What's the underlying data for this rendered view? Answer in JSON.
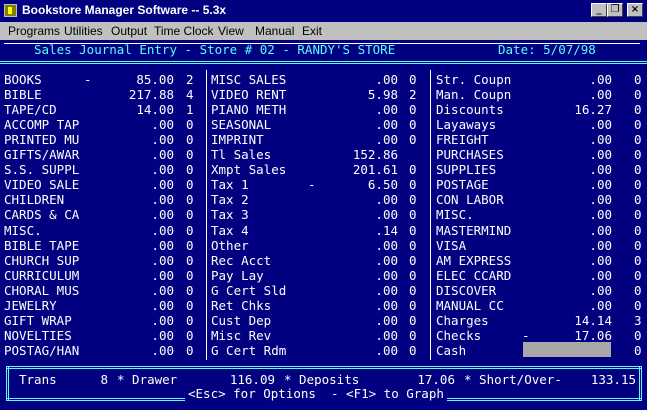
{
  "window": {
    "title": "Bookstore Manager Software -- 5.3x",
    "controls": [
      {
        "name": "minimize-button",
        "glyph": "_"
      },
      {
        "name": "maximize-button",
        "glyph": "❐"
      },
      {
        "name": "close-button",
        "glyph": "×"
      }
    ]
  },
  "menu": [
    "Programs",
    "Utilities",
    "Output",
    "Time Clock",
    "View",
    "Manual",
    "Exit"
  ],
  "header": {
    "title": "Sales Journal Entry - Store # 02 - RANDY'S STORE",
    "date": "Date: 5/07/98"
  },
  "col1": [
    {
      "label": "BOOKS",
      "mark": "-",
      "amount": "85.00",
      "count": "2"
    },
    {
      "label": "BIBLE",
      "mark": "",
      "amount": "217.88",
      "count": "4"
    },
    {
      "label": "TAPE/CD",
      "mark": "",
      "amount": "14.00",
      "count": "1"
    },
    {
      "label": "ACCOMP TAP",
      "mark": "",
      "amount": ".00",
      "count": "0"
    },
    {
      "label": "PRINTED MU",
      "mark": "",
      "amount": ".00",
      "count": "0"
    },
    {
      "label": "GIFTS/AWAR",
      "mark": "",
      "amount": ".00",
      "count": "0"
    },
    {
      "label": "S.S. SUPPL",
      "mark": "",
      "amount": ".00",
      "count": "0"
    },
    {
      "label": "VIDEO SALE",
      "mark": "",
      "amount": ".00",
      "count": "0"
    },
    {
      "label": "CHILDREN",
      "mark": "",
      "amount": ".00",
      "count": "0"
    },
    {
      "label": "CARDS & CA",
      "mark": "",
      "amount": ".00",
      "count": "0"
    },
    {
      "label": "MISC.",
      "mark": "",
      "amount": ".00",
      "count": "0"
    },
    {
      "label": "BIBLE TAPE",
      "mark": "",
      "amount": ".00",
      "count": "0"
    },
    {
      "label": "CHURCH SUP",
      "mark": "",
      "amount": ".00",
      "count": "0"
    },
    {
      "label": "CURRICULUM",
      "mark": "",
      "amount": ".00",
      "count": "0"
    },
    {
      "label": "CHORAL MUS",
      "mark": "",
      "amount": ".00",
      "count": "0"
    },
    {
      "label": "JEWELRY",
      "mark": "",
      "amount": ".00",
      "count": "0"
    },
    {
      "label": "GIFT WRAP",
      "mark": "",
      "amount": ".00",
      "count": "0"
    },
    {
      "label": "NOVELTIES",
      "mark": "",
      "amount": ".00",
      "count": "0"
    },
    {
      "label": "POSTAG/HAN",
      "mark": "",
      "amount": ".00",
      "count": "0"
    }
  ],
  "col2": [
    {
      "label": "MISC SALES",
      "mark": "",
      "amount": ".00",
      "count": "0"
    },
    {
      "label": "VIDEO RENT",
      "mark": "",
      "amount": "5.98",
      "count": "2"
    },
    {
      "label": "PIANO METH",
      "mark": "",
      "amount": ".00",
      "count": "0"
    },
    {
      "label": "SEASONAL",
      "mark": "",
      "amount": ".00",
      "count": "0"
    },
    {
      "label": "IMPRINT",
      "mark": "",
      "amount": ".00",
      "count": "0"
    },
    {
      "label": "Tl Sales",
      "mark": "",
      "amount": "152.86",
      "count": ""
    },
    {
      "label": "Xmpt Sales",
      "mark": "",
      "amount": "201.61",
      "count": "0"
    },
    {
      "label": "Tax 1",
      "mark": "-",
      "amount": "6.50",
      "count": "0"
    },
    {
      "label": "Tax 2",
      "mark": "",
      "amount": ".00",
      "count": "0"
    },
    {
      "label": "Tax 3",
      "mark": "",
      "amount": ".00",
      "count": "0"
    },
    {
      "label": "Tax 4",
      "mark": "",
      "amount": ".14",
      "count": "0"
    },
    {
      "label": "Other",
      "mark": "",
      "amount": ".00",
      "count": "0"
    },
    {
      "label": "Rec Acct",
      "mark": "",
      "amount": ".00",
      "count": "0"
    },
    {
      "label": "Pay Lay",
      "mark": "",
      "amount": ".00",
      "count": "0"
    },
    {
      "label": "G Cert Sld",
      "mark": "",
      "amount": ".00",
      "count": "0"
    },
    {
      "label": "Ret Chks",
      "mark": "",
      "amount": ".00",
      "count": "0"
    },
    {
      "label": "Cust Dep",
      "mark": "",
      "amount": ".00",
      "count": "0"
    },
    {
      "label": "Misc Rev",
      "mark": "",
      "amount": ".00",
      "count": "0"
    },
    {
      "label": "G Cert Rdm",
      "mark": "",
      "amount": ".00",
      "count": "0"
    }
  ],
  "col3": [
    {
      "label": "Str. Coupn",
      "mark": "",
      "amount": ".00",
      "count": "0"
    },
    {
      "label": "Man. Coupn",
      "mark": "",
      "amount": ".00",
      "count": "0"
    },
    {
      "label": "Discounts",
      "mark": "",
      "amount": "16.27",
      "count": "0"
    },
    {
      "label": "Layaways",
      "mark": "",
      "amount": ".00",
      "count": "0"
    },
    {
      "label": "FREIGHT",
      "mark": "",
      "amount": ".00",
      "count": "0"
    },
    {
      "label": "PURCHASES",
      "mark": "",
      "amount": ".00",
      "count": "0"
    },
    {
      "label": "SUPPLIES",
      "mark": "",
      "amount": ".00",
      "count": "0"
    },
    {
      "label": "POSTAGE",
      "mark": "",
      "amount": ".00",
      "count": "0"
    },
    {
      "label": "CON LABOR",
      "mark": "",
      "amount": ".00",
      "count": "0"
    },
    {
      "label": "MISC.",
      "mark": "",
      "amount": ".00",
      "count": "0"
    },
    {
      "label": "MASTERMIND",
      "mark": "",
      "amount": ".00",
      "count": "0"
    },
    {
      "label": "VISA",
      "mark": "",
      "amount": ".00",
      "count": "0"
    },
    {
      "label": "AM EXPRESS",
      "mark": "",
      "amount": ".00",
      "count": "0"
    },
    {
      "label": "ELEC CCARD",
      "mark": "",
      "amount": ".00",
      "count": "0"
    },
    {
      "label": "DISCOVER",
      "mark": "",
      "amount": ".00",
      "count": "0"
    },
    {
      "label": "MANUAL CC",
      "mark": "",
      "amount": ".00",
      "count": "0"
    },
    {
      "label": "Charges",
      "mark": "",
      "amount": "14.14",
      "count": "3"
    },
    {
      "label": "Checks",
      "mark": "-",
      "amount": "17.06",
      "count": "0"
    },
    {
      "label": "Cash",
      "mark": "",
      "amount": "",
      "count": "0"
    }
  ],
  "footer": {
    "trans_label": "Trans",
    "trans_value": "8",
    "drawer_label": "* Drawer",
    "drawer_value": "116.09",
    "deposits_label": "* Deposits",
    "deposits_value": "17.06",
    "short_over_label": "* Short/Over-",
    "short_over_value": "133.15",
    "hint": "<Esc> for Options  - <F1> to Graph"
  }
}
